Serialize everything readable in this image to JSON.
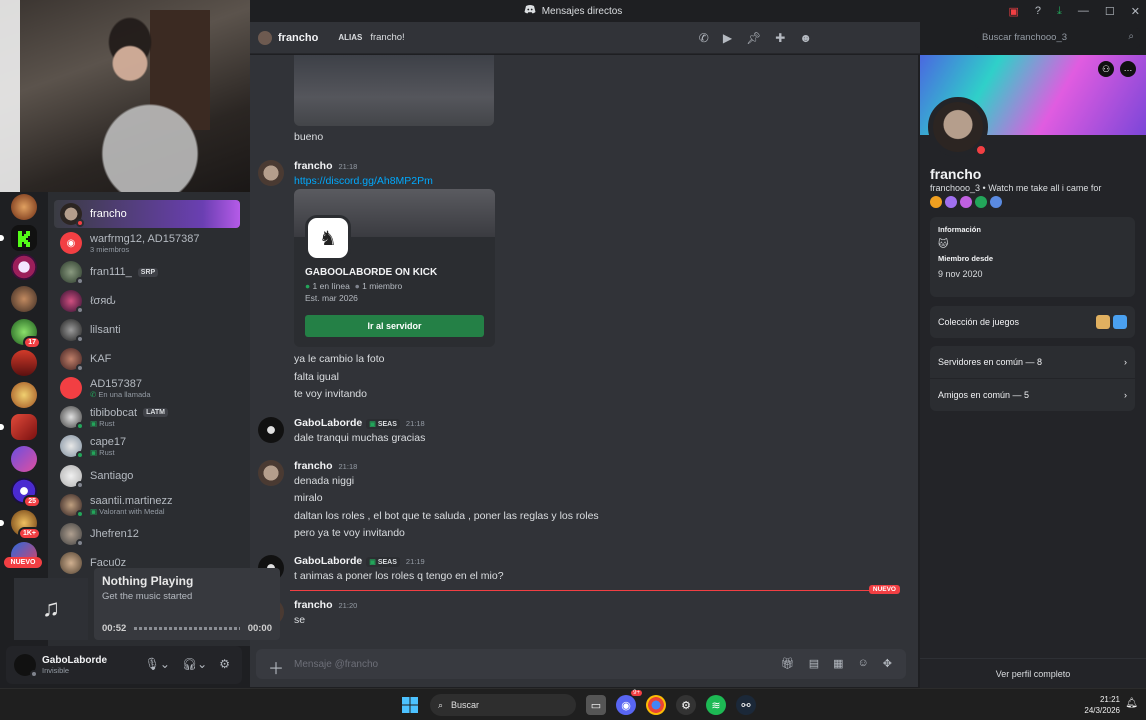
{
  "window": {
    "title": "Mensajes directos"
  },
  "header": {
    "username": "francho",
    "alias_label": "ALIAS",
    "alias_value": "francho!",
    "search_placeholder": "Buscar franchooo_3"
  },
  "servers": {
    "badges": [
      "17",
      "25",
      "1K+"
    ],
    "new_label": "NUEVO"
  },
  "dms": [
    {
      "name": "francho",
      "sub": "",
      "tag": "",
      "status": "dnd",
      "active": true
    },
    {
      "name": "warfrmg12, AD157387",
      "sub": "3 miembros",
      "tag": "",
      "status": "",
      "active": false
    },
    {
      "name": "fran111_",
      "sub": "",
      "tag": "SRP",
      "status": "offline",
      "active": false
    },
    {
      "name": "ℓσяԃ",
      "sub": "",
      "tag": "",
      "status": "offline",
      "active": false
    },
    {
      "name": "lilsanti",
      "sub": "",
      "tag": "",
      "status": "offline",
      "active": false
    },
    {
      "name": "KAF",
      "sub": "",
      "tag": "",
      "status": "offline",
      "active": false
    },
    {
      "name": "AD157387",
      "sub": "En una llamada",
      "tag": "",
      "status": "",
      "active": false
    },
    {
      "name": "tibibobcat",
      "sub": "Rust",
      "tag": "LATM",
      "status": "online",
      "active": false
    },
    {
      "name": "cape17",
      "sub": "Rust",
      "tag": "",
      "status": "online",
      "active": false
    },
    {
      "name": "Santiago",
      "sub": "",
      "tag": "",
      "status": "offline",
      "active": false
    },
    {
      "name": "saantii.martinezz",
      "sub": "Valorant with Medal",
      "tag": "",
      "status": "online",
      "active": false
    },
    {
      "name": "Jhefren12",
      "sub": "",
      "tag": "",
      "status": "offline",
      "active": false
    },
    {
      "name": "Facu0z",
      "sub": "",
      "tag": "",
      "status": "offline",
      "active": false
    }
  ],
  "user_panel": {
    "name": "GaboLaborde",
    "status": "Invisible"
  },
  "now_playing": {
    "title": "Nothing Playing",
    "subtitle": "Get the music started",
    "elapsed": "00:52",
    "remaining": "00:00"
  },
  "messages": {
    "m0_text": "bueno",
    "m1_author": "francho",
    "m1_time": "21:18",
    "m1_link": "https://discord.gg/Ah8MP2Pm",
    "invite": {
      "title": "GABOOLABORDE ON KICK",
      "online": "1 en línea",
      "members": "1 miembro",
      "est": "Est. mar 2026",
      "button": "Ir al servidor"
    },
    "m1_lines": [
      "ya le cambio la foto",
      "falta igual",
      "te voy invitando"
    ],
    "m2_author": "GaboLaborde",
    "m2_tag": "SEAS",
    "m2_time": "21:18",
    "m2_text": "dale tranqui muchas gracias",
    "m3_author": "francho",
    "m3_time": "21:18",
    "m3_lines": [
      "denada niggi",
      "miralo",
      "daltan los roles , el bot que te saluda , poner las reglas y los roles",
      "pero ya te voy invitando"
    ],
    "m4_author": "GaboLaborde",
    "m4_tag": "SEAS",
    "m4_time": "21:19",
    "m4_text": "t animas a poner los roles q tengo en el  mio?",
    "new_label": "NUEVO",
    "m5_author": "francho",
    "m5_time": "21:20",
    "m5_text": "se"
  },
  "composer": {
    "placeholder": "Mensaje @francho"
  },
  "profile": {
    "display_name": "francho",
    "username_line": "franchooo_3 • Watch me take all i came for",
    "info_label": "Información",
    "member_since_label": "Miembro desde",
    "member_since": "9 nov 2020",
    "games_label": "Colección de juegos",
    "servers_common": "Servidores en común — 8",
    "friends_common": "Amigos en común — 5",
    "full_profile": "Ver perfil completo"
  },
  "taskbar": {
    "search": "Buscar",
    "time": "21:21",
    "date": "24/3/2026",
    "discord_badge": "9+"
  },
  "colors": {
    "background": "#313338",
    "accent": "#5865f2",
    "danger": "#f23f43",
    "online": "#23a55a"
  }
}
